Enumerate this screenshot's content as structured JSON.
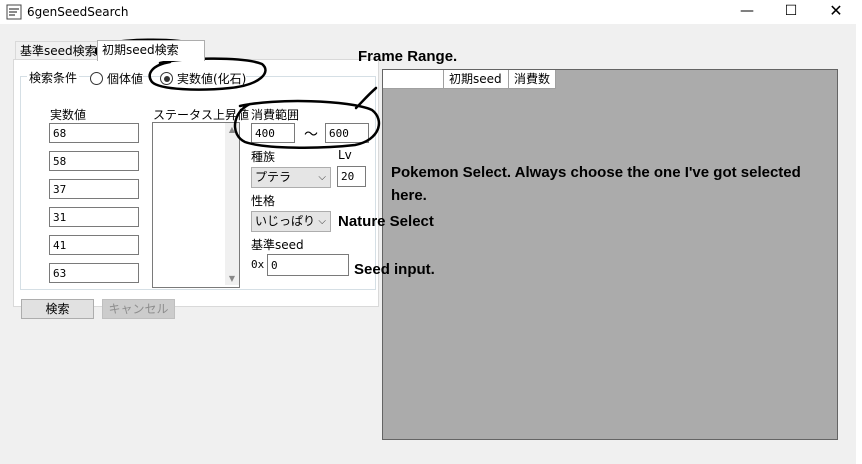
{
  "window": {
    "title": "6genSeedSearch",
    "minimize_glyph": "—",
    "maximize_glyph": "☐",
    "close_glyph": "✕"
  },
  "tabs": [
    {
      "label": "基準seed検索",
      "active": false
    },
    {
      "label": "初期seed検索",
      "active": true
    }
  ],
  "search": {
    "group_label": "検索条件",
    "mode_options": [
      {
        "label": "個体値",
        "selected": false
      },
      {
        "label": "実数値(化石)",
        "selected": true
      }
    ],
    "stats_label": "実数値",
    "stats_values": [
      "68",
      "58",
      "37",
      "31",
      "41",
      "63"
    ],
    "stat_up_label": "ステータス上昇値",
    "frame_range_label": "消費範囲",
    "frame_min": "400",
    "frame_separator": "～",
    "frame_max": "600",
    "species_label": "種族",
    "species_value": "プテラ",
    "level_label": "Lv",
    "level_value": "20",
    "nature_label": "性格",
    "nature_value": "いじっぱり",
    "seed_label": "基準seed",
    "seed_prefix": "0x",
    "seed_value": "0"
  },
  "buttons": {
    "search": "検索",
    "cancel": "キャンセル"
  },
  "results": {
    "columns": [
      "",
      "初期seed",
      "消費数"
    ]
  },
  "annotations": {
    "frame_range": "Frame Range.",
    "pokemon_select": "Pokemon Select. Always choose the one I've got selected",
    "pokemon_select_line2": "here.",
    "nature_select": "Nature Select",
    "seed_input": "Seed input."
  }
}
